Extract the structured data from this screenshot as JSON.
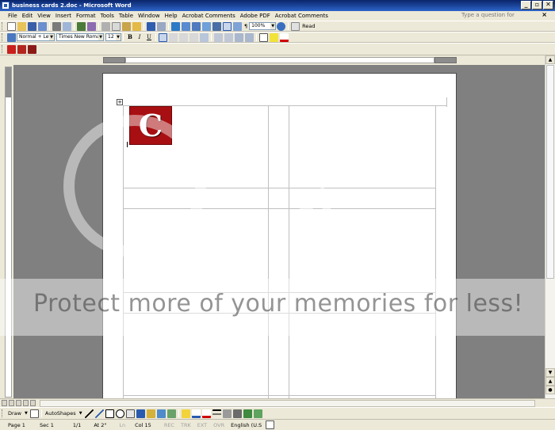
{
  "window": {
    "title": "business cards 2.doc - Microsoft Word",
    "buttons": [
      "_",
      "▫",
      "✕"
    ]
  },
  "menubar": {
    "items": [
      "File",
      "Edit",
      "View",
      "Insert",
      "Format",
      "Tools",
      "Table",
      "Window",
      "Help",
      "Acrobat Comments",
      "Adobe PDF",
      "Acrobat Comments"
    ],
    "help_placeholder": "Type a question for help",
    "close_doc": "×"
  },
  "standard_toolbar": {
    "zoom": "100%",
    "read_label": "Read"
  },
  "formatting_toolbar": {
    "style": "Normal + Left:",
    "font": "Times New Roman",
    "size": "12",
    "bold": "B",
    "italic": "I",
    "underline": "U"
  },
  "document": {
    "logo_letter": "C",
    "table_handle": "+",
    "logo_color": "#a80f12"
  },
  "watermark": {
    "text_right": "et",
    "protect_text": "Protect more of your memories for less!"
  },
  "drawing_toolbar": {
    "draw_label": "Draw",
    "autoshapes_label": "AutoShapes"
  },
  "statusbar": {
    "page": "Page  1",
    "sec": "Sec  1",
    "pages": "1/1",
    "at": "At  2\"",
    "ln": "Ln",
    "col": "Col  15",
    "rec": "REC",
    "trk": "TRK",
    "ext": "EXT",
    "ovr": "OVR",
    "language": "English (U.S"
  }
}
